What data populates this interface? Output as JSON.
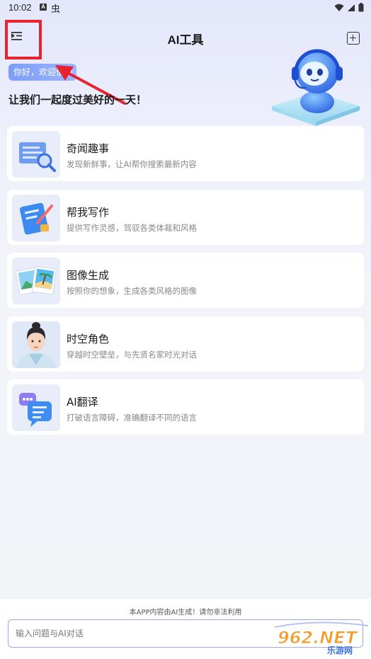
{
  "status_bar": {
    "time": "10:02",
    "a_icon": "A",
    "bug_icon": "虫"
  },
  "header": {
    "title": "AI工具",
    "menu_icon": "menu-icon",
    "add_icon": "add-icon"
  },
  "hero": {
    "hello": "你好，欢迎使用",
    "greeting": "让我们一起度过美好的一天！"
  },
  "tools": [
    {
      "title": "奇闻趣事",
      "desc": "发现新鲜事，让AI帮你搜索最新内容",
      "icon": "news-search-icon"
    },
    {
      "title": "帮我写作",
      "desc": "提供写作灵感，驾驭各类体裁和风格",
      "icon": "writing-book-icon"
    },
    {
      "title": "图像生成",
      "desc": "按照你的想象，生成各类风格的图像",
      "icon": "photos-icon"
    },
    {
      "title": "时空角色",
      "desc": "穿越时空壁垒，与先贤名家时光对话",
      "icon": "historical-character-avatar"
    },
    {
      "title": "AI翻译",
      "desc": "打破语言障碍，准确翻译不同的语言",
      "icon": "translate-chat-icon"
    }
  ],
  "footer": {
    "disclaimer": "本APP内容由AI生成！请勿非法利用",
    "input_placeholder": "输入问题与AI对话"
  },
  "watermark": {
    "brand": "962.NET",
    "sub": "乐游网"
  },
  "colors": {
    "accent": "#7c9cf7",
    "highlight": "#e8232f"
  }
}
